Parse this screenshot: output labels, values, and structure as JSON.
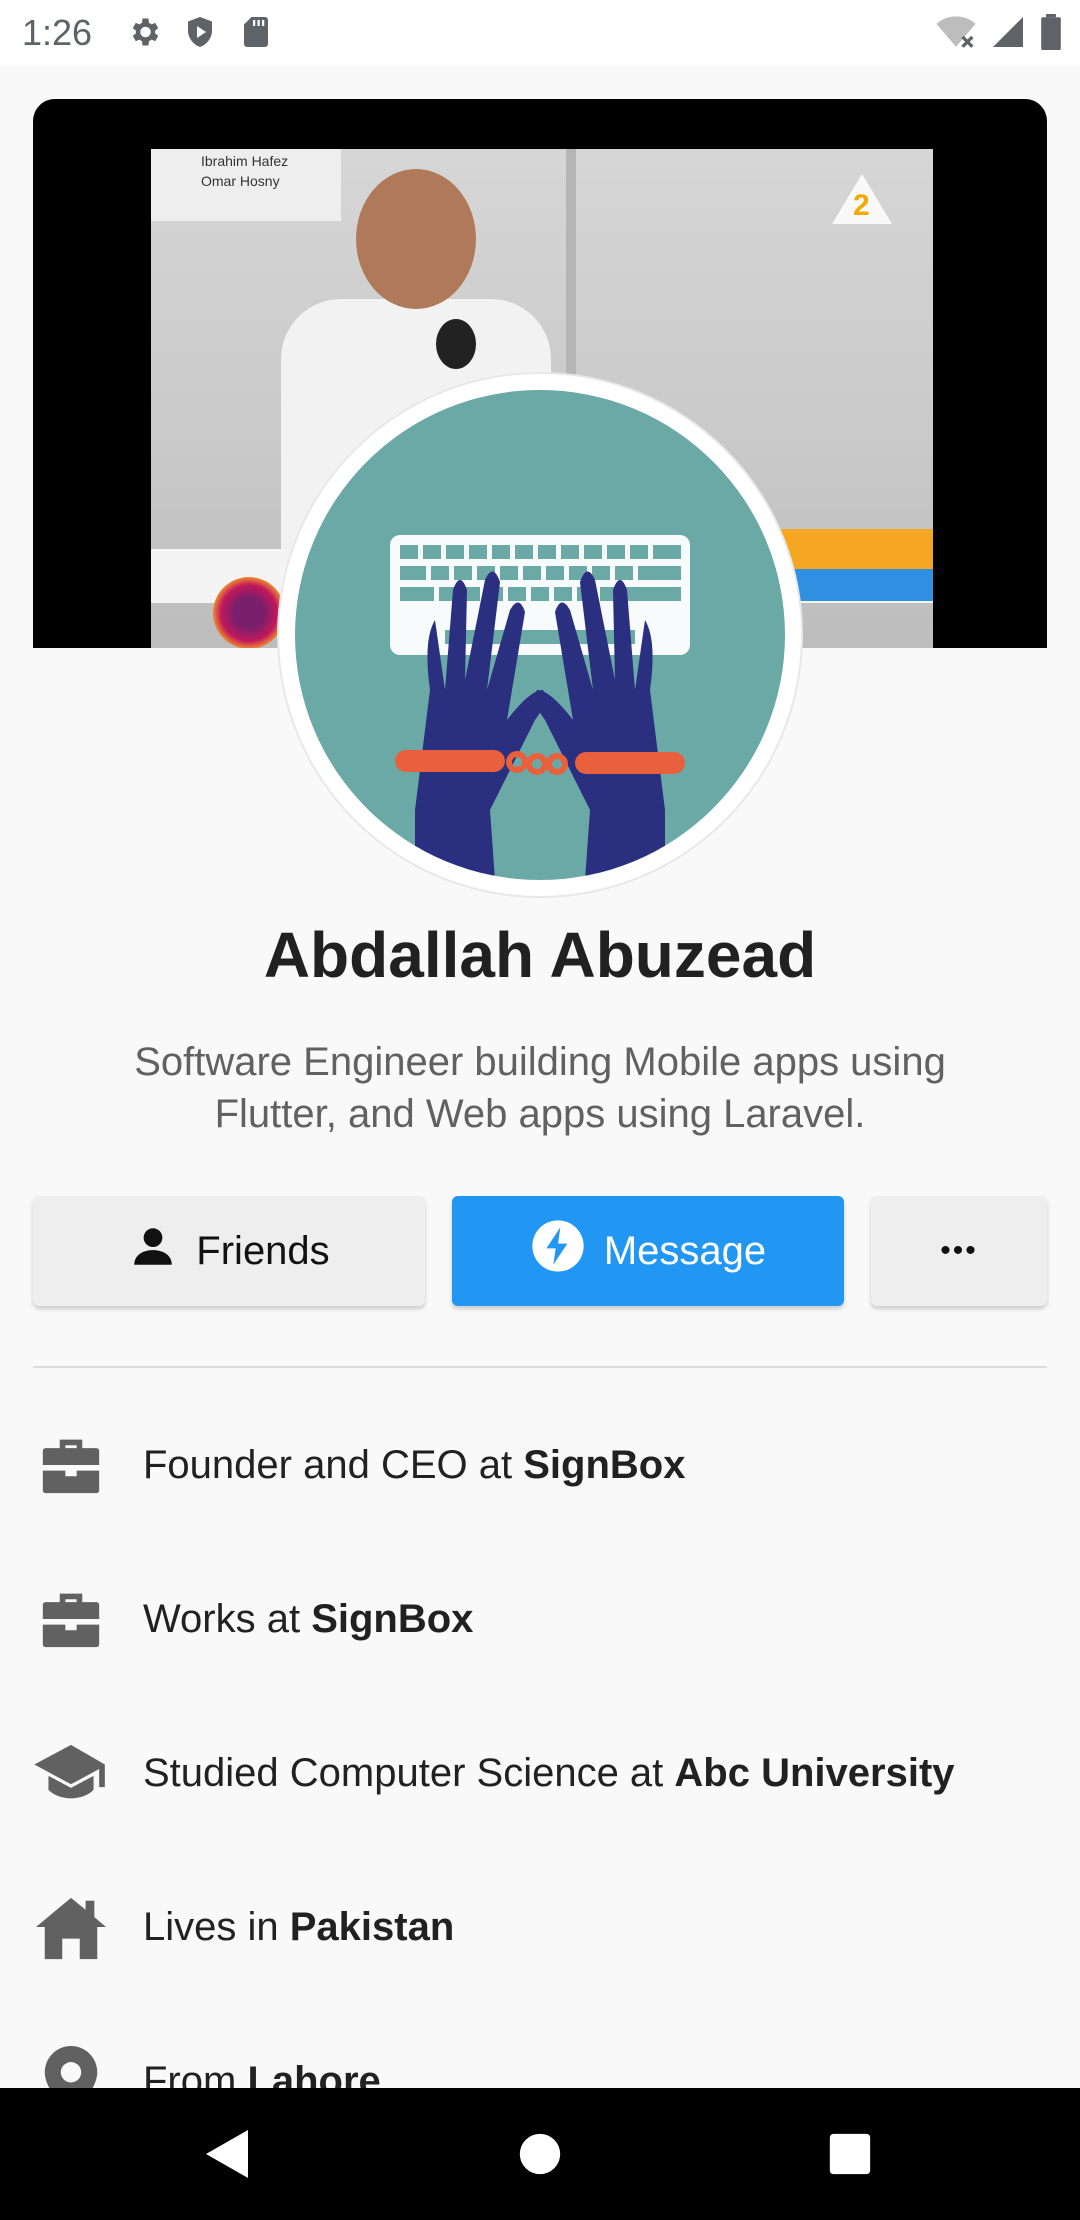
{
  "status_bar": {
    "time": "1:26",
    "icons_left": [
      "gear-icon",
      "shield-icon",
      "sd-card-icon"
    ],
    "icons_right": [
      "wifi-off-icon",
      "signal-icon",
      "battery-icon"
    ]
  },
  "profile": {
    "name": "Abdallah Abuzead",
    "bio": "Software Engineer building Mobile apps using Flutter, and Web apps using Laravel.",
    "cover_caption_line1": "Ibrahim Hafez",
    "cover_caption_line2": "Omar Hosny"
  },
  "actions": {
    "friends_label": "Friends",
    "message_label": "Message",
    "more_label": "•••"
  },
  "colors": {
    "accent": "#2196f3",
    "avatar_bg": "#6aa9a6",
    "page_bg": "#f9f9f9"
  },
  "info": [
    {
      "icon": "briefcase-icon",
      "prefix": "Founder and CEO at ",
      "bold": "SignBox"
    },
    {
      "icon": "briefcase-icon",
      "prefix": "Works at ",
      "bold": "SignBox"
    },
    {
      "icon": "graduation-cap-icon",
      "prefix": "Studied Computer Science at ",
      "bold": "Abc University"
    },
    {
      "icon": "home-icon",
      "prefix": "Lives in ",
      "bold": "Pakistan"
    },
    {
      "icon": "location-pin-icon",
      "prefix": "From ",
      "bold": "Lahore"
    }
  ],
  "nav": {
    "icons": [
      "back-icon",
      "home-circle-icon",
      "recents-icon"
    ]
  }
}
